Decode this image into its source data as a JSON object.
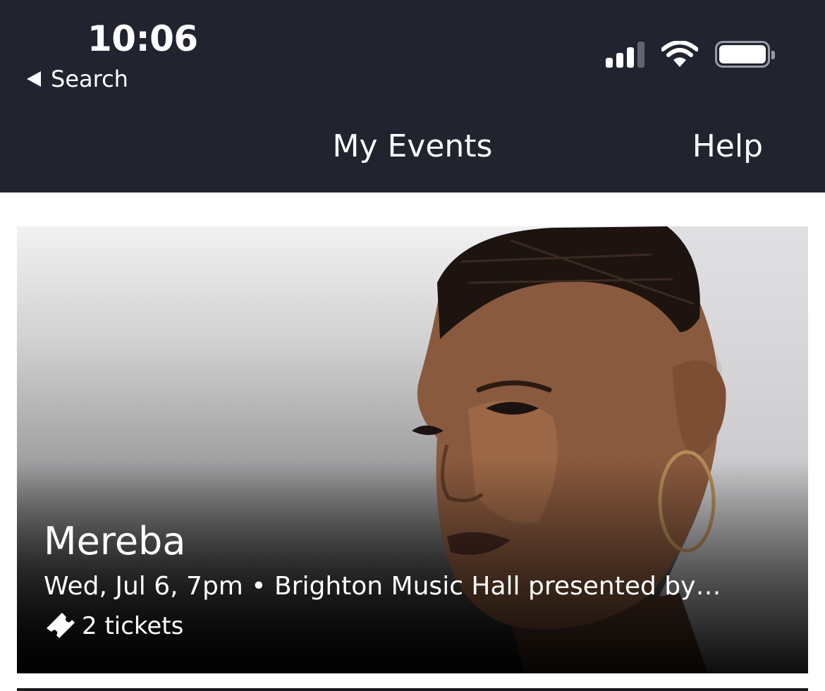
{
  "status_bar": {
    "time": "10:06",
    "back_label": "Search",
    "icons": [
      "cellular-signal-icon",
      "wifi-icon",
      "battery-icon"
    ]
  },
  "nav": {
    "title": "My Events",
    "help_label": "Help"
  },
  "event": {
    "name": "Mereba",
    "meta": "Wed, Jul 6, 7pm • Brighton Music Hall presented by…",
    "tickets_label": "2 tickets",
    "ticket_icon": "ticket-icon",
    "image": "artist-portrait"
  },
  "colors": {
    "header_bg": "#21242e",
    "text_on_dark": "#ffffff",
    "page_bg": "#ffffff"
  }
}
